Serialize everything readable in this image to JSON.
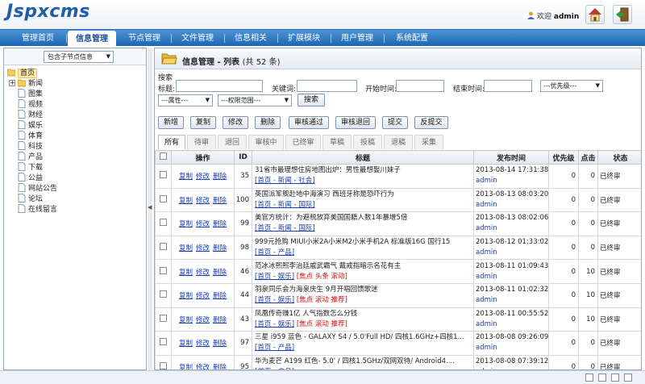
{
  "header": {
    "logo": "Jspxcms",
    "welcome_prefix": "欢迎",
    "username": "admin",
    "home_icon": "home-icon",
    "logout_icon": "logout-icon"
  },
  "nav": {
    "items": [
      {
        "label": "管理首页",
        "active": false
      },
      {
        "label": "信息管理",
        "active": true
      },
      {
        "label": "节点管理",
        "active": false
      },
      {
        "label": "文件管理",
        "active": false
      },
      {
        "label": "信息相关",
        "active": false
      },
      {
        "label": "扩展模块",
        "active": false
      },
      {
        "label": "用户管理",
        "active": false
      },
      {
        "label": "系统配置",
        "active": false
      }
    ]
  },
  "sidebar": {
    "scope_select": "包含子节点信息",
    "tree": [
      {
        "label": "首页",
        "level": 0,
        "icon": "folder-icon",
        "selected": true
      },
      {
        "label": "新闻",
        "level": 1,
        "icon": "folder-icon",
        "expandable": true
      },
      {
        "label": "图集",
        "level": 1,
        "icon": "page-icon"
      },
      {
        "label": "视频",
        "level": 1,
        "icon": "page-icon"
      },
      {
        "label": "财经",
        "level": 1,
        "icon": "page-icon"
      },
      {
        "label": "娱乐",
        "level": 1,
        "icon": "page-icon"
      },
      {
        "label": "体育",
        "level": 1,
        "icon": "page-icon"
      },
      {
        "label": "科技",
        "level": 1,
        "icon": "page-icon"
      },
      {
        "label": "产品",
        "level": 1,
        "icon": "page-icon"
      },
      {
        "label": "下载",
        "level": 1,
        "icon": "page-icon"
      },
      {
        "label": "公益",
        "level": 1,
        "icon": "page-icon"
      },
      {
        "label": "网站公告",
        "level": 1,
        "icon": "page-icon"
      },
      {
        "label": "论坛",
        "level": 1,
        "icon": "page-icon"
      },
      {
        "label": "在线留言",
        "level": 1,
        "icon": "page-icon"
      }
    ]
  },
  "main": {
    "title": "信息管理 - 列表",
    "count": "(共 52 条)",
    "search": {
      "section_label": "搜索",
      "title_label": "标题:",
      "keyword_label": "关键词:",
      "start_label": "开始时间:",
      "end_label": "结束时间:",
      "priority_select": "---优先级---",
      "attribute_select": "---属性---",
      "permission_select": "---权限范围---",
      "search_button": "搜索"
    },
    "toolbar": [
      "新增",
      "复制",
      "修改",
      "删除",
      "审核通过",
      "审核退回",
      "提交",
      "反提交"
    ],
    "tabs": [
      {
        "label": "所有",
        "active": true
      },
      {
        "label": "待审",
        "active": false
      },
      {
        "label": "退回",
        "active": false
      },
      {
        "label": "审核中",
        "active": false
      },
      {
        "label": "已终审",
        "active": false
      },
      {
        "label": "草稿",
        "active": false
      },
      {
        "label": "投稿",
        "active": false
      },
      {
        "label": "退稿",
        "active": false
      },
      {
        "label": "采集",
        "active": false
      }
    ],
    "table": {
      "headers": [
        "操作",
        "ID",
        "标题",
        "发布时间",
        "优先级",
        "点击",
        "状态"
      ],
      "op_labels": [
        "复制",
        "修改",
        "删除"
      ],
      "rows": [
        {
          "id": "35",
          "title": "31省市最理想住房地图出炉：男性最想娶川妹子",
          "node": "[首页 - 新闻 - 社会]",
          "attrs": "",
          "date": "2013-08-14 17:31:38",
          "author": "admin",
          "priority": "0",
          "views": "0",
          "status": "已终审"
        },
        {
          "id": "100",
          "title": "英国派军舰赴地中海演习 西班牙称是恐吓行为",
          "node": "[首页 - 新闻 - 国际]",
          "attrs": "",
          "date": "2013-08-13 08:03:20",
          "author": "admin",
          "priority": "0",
          "views": "0",
          "status": "已终审"
        },
        {
          "id": "99",
          "title": "美官方统计：为避税放弃美国国籍人数1年暴增5倍",
          "node": "[首页 - 新闻 - 国际]",
          "attrs": "",
          "date": "2013-08-13 08:02:06",
          "author": "admin",
          "priority": "0",
          "views": "0",
          "status": "已终审"
        },
        {
          "id": "98",
          "title": "999元抢购 MIUI小米2A小米M2小米手机2A 标准版16G 国行15",
          "node": "[首页 - 产品]",
          "attrs": "",
          "date": "2013-08-12 01:33:02",
          "author": "admin",
          "priority": "0",
          "views": "0",
          "status": "已终审"
        },
        {
          "id": "46",
          "title": "范冰冰熙熙李治廷戚武霸气 戴戒指暗示名花有主",
          "node": "[首页 - 娱乐]",
          "attrs": "[焦点 头条 滚动]",
          "date": "2013-08-11 01:09:43",
          "author": "admin",
          "priority": "0",
          "views": "10",
          "status": "已终审"
        },
        {
          "id": "44",
          "title": "羽泉同乐会为海泉庆生 9月开唱回馈歌迷",
          "node": "[首页 - 娱乐]",
          "attrs": "[焦点 滚动 推荐]",
          "date": "2013-08-11 01:02:32",
          "author": "admin",
          "priority": "0",
          "views": "10",
          "status": "已终审"
        },
        {
          "id": "43",
          "title": "凤凰传奇赚1亿 人气指数怎么分钱",
          "node": "[首页 - 娱乐]",
          "attrs": "[焦点 滚动 推荐]",
          "date": "2013-08-11 00:55:52",
          "author": "admin",
          "priority": "0",
          "views": "10",
          "status": "已终审"
        },
        {
          "id": "97",
          "title": "三星 i959 蓝色 - GALAXY S4 / 5.0'Full HD/ 四核1.6GHz+四核1...",
          "node": "[首页 - 产品]",
          "attrs": "",
          "date": "2013-08-08 09:26:09",
          "author": "admin",
          "priority": "0",
          "views": "0",
          "status": "已终审"
        },
        {
          "id": "95",
          "title": "华为麦芒 A199 红色- 5.0' / 四核1.5GHz/双网双待/ Android4....",
          "node": "[首页 - 产品]",
          "attrs": "",
          "date": "2013-08-08 07:39:12",
          "author": "admin",
          "priority": "0",
          "views": "0",
          "status": "已终审"
        }
      ]
    }
  },
  "colors": {
    "nav_bg": "#2b74c0",
    "link": "#1a3fb0",
    "attr_red": "#d01010"
  }
}
